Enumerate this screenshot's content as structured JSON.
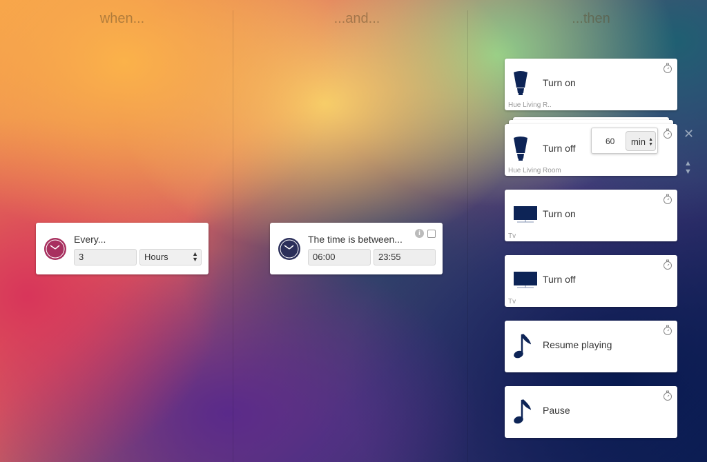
{
  "columns": {
    "when": "when...",
    "and": "...and...",
    "then": "...then"
  },
  "when_card": {
    "label": "Every...",
    "interval_value": "3",
    "unit": "Hours",
    "icon": "clock-icon",
    "icon_color": "#a8305f"
  },
  "and_card": {
    "label": "The time is between...",
    "start": "06:00",
    "end": "23:55",
    "icon": "clock-icon",
    "icon_color": "#2b2f5a",
    "checked": false
  },
  "actions": [
    {
      "title": "Turn on",
      "device": "Hue Living R..",
      "icon": "bulb-icon"
    },
    {
      "title": "Turn off",
      "device": "Hue Living Room",
      "icon": "bulb-icon",
      "delay": {
        "value": "60",
        "unit": "min"
      }
    },
    {
      "title": "Turn on",
      "device": "Tv",
      "icon": "tv-icon"
    },
    {
      "title": "Turn off",
      "device": "Tv",
      "icon": "tv-icon"
    },
    {
      "title": "Resume playing",
      "device": "",
      "icon": "music-note-icon"
    },
    {
      "title": "Pause",
      "device": "",
      "icon": "music-note-icon"
    }
  ],
  "colors": {
    "icon": "#0d2456"
  }
}
